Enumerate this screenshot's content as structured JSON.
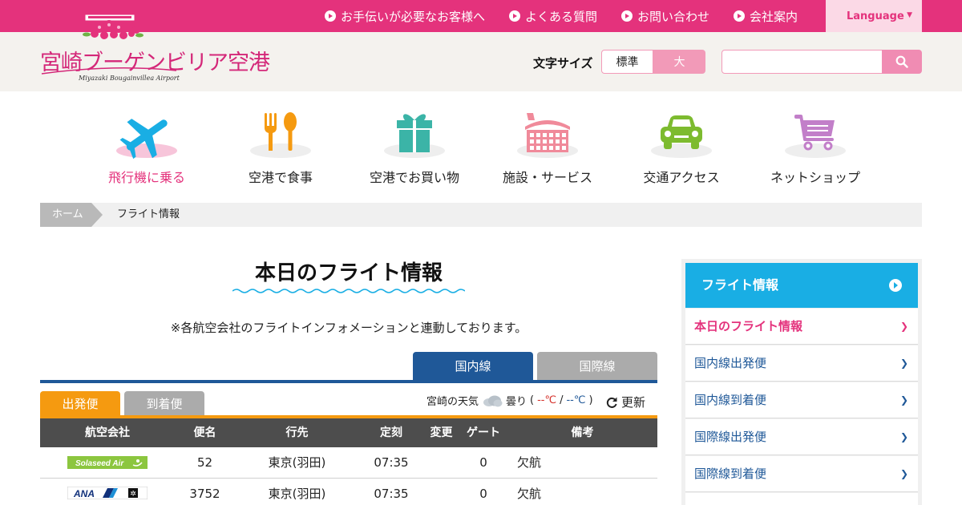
{
  "topbar": {
    "links": [
      {
        "label": "お手伝いが必要なお客様へ"
      },
      {
        "label": "よくある質問"
      },
      {
        "label": "お問い合わせ"
      },
      {
        "label": "会社案内"
      }
    ],
    "language": "Language"
  },
  "header": {
    "logo_text": "宮崎ブーゲンビリア空港",
    "logo_sub": "Miyazaki Bougainvillea Airport",
    "font_size_label": "文字サイズ",
    "font_normal": "標準",
    "font_large": "大",
    "search_placeholder": ""
  },
  "categories": [
    {
      "label": "飛行機に乗る",
      "icon": "airplane-icon",
      "color": "#19aee4",
      "active": true
    },
    {
      "label": "空港で食事",
      "icon": "fork-spoon-icon",
      "color": "#f59a10"
    },
    {
      "label": "空港でお買い物",
      "icon": "gift-icon",
      "color": "#3bb4a7"
    },
    {
      "label": "施設・サービス",
      "icon": "terminal-icon",
      "color": "#f08a9a"
    },
    {
      "label": "交通アクセス",
      "icon": "car-icon",
      "color": "#7dbb2f"
    },
    {
      "label": "ネットショップ",
      "icon": "cart-icon",
      "color": "#c27fc9"
    }
  ],
  "breadcrumb": {
    "home": "ホーム",
    "current": "フライト情報"
  },
  "main": {
    "title": "本日のフライト情報",
    "note": "※各航空会社のフライトインフォメーションと連動しております。",
    "tab_domestic": "国内線",
    "tab_international": "国際線",
    "tab_departure": "出発便",
    "tab_arrival": "到着便",
    "weather": {
      "label": "宮崎の天気",
      "condition": "曇り",
      "open": "(",
      "max": "--℃",
      "sep": "/",
      "min": "--℃",
      "close": ")"
    },
    "refresh": "更新"
  },
  "table": {
    "headers": [
      "航空会社",
      "便名",
      "行先",
      "定刻",
      "変更",
      "ゲート",
      "備考"
    ],
    "rows": [
      {
        "airline": "Solaseed Air",
        "flight": "52",
        "dest": "東京(羽田)",
        "time": "07:35",
        "change": "",
        "gate": "0",
        "note": "欠航"
      },
      {
        "airline": "ANA",
        "flight": "3752",
        "dest": "東京(羽田)",
        "time": "07:35",
        "change": "",
        "gate": "0",
        "note": "欠航"
      }
    ]
  },
  "sidebar": {
    "head": "フライト情報",
    "items": [
      {
        "label": "本日のフライト情報",
        "active": true
      },
      {
        "label": "国内線出発便"
      },
      {
        "label": "国内線到着便"
      },
      {
        "label": "国際線出発便"
      },
      {
        "label": "国際線到着便"
      }
    ]
  },
  "colors": {
    "brand_pink": "#e4327c",
    "navy": "#1f5898",
    "orange": "#f59a10",
    "sky": "#19aee4"
  }
}
